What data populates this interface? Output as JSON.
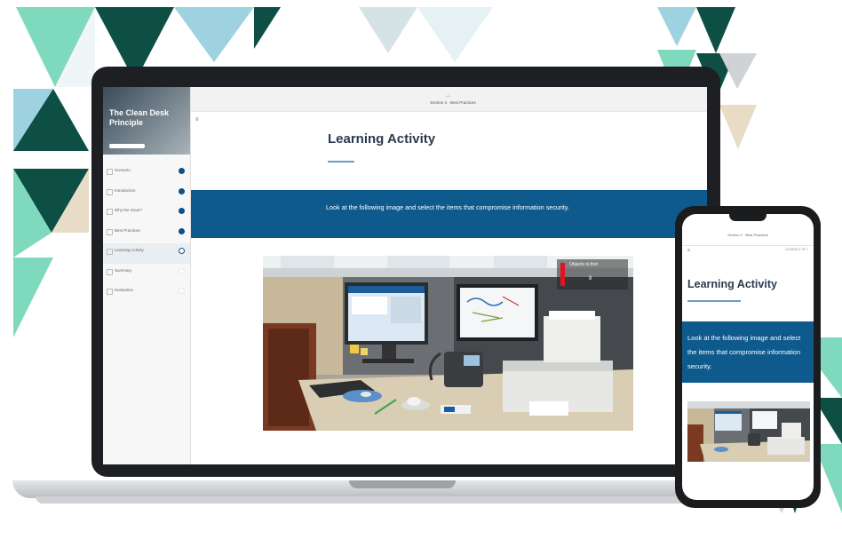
{
  "course": {
    "title": "The Clean Desk Principle",
    "lesson_title": "Section 4 · Best Practices"
  },
  "sidebar": {
    "items": [
      {
        "label": "Scenario",
        "status": "complete"
      },
      {
        "label": "Introduction",
        "status": "complete"
      },
      {
        "label": "Why the Issue?",
        "status": "complete"
      },
      {
        "label": "Best Practices",
        "status": "complete"
      },
      {
        "label": "Learning Activity",
        "status": "in-progress"
      },
      {
        "label": "Summary",
        "status": "not-started"
      },
      {
        "label": "Evaluation",
        "status": "not-started"
      }
    ]
  },
  "activity": {
    "heading": "Learning Activity",
    "instruction": "Look at the following image and select the items that compromise information security.",
    "objects_label": "Objects to find",
    "objects_count": "8"
  },
  "phone": {
    "top_right": "LESSON 4 OF 7"
  },
  "icons": {
    "menu": "hamburger-menu-icon",
    "caret": "chevron-up-icon",
    "complete": "filled-circle-icon",
    "progress": "half-circle-icon"
  },
  "colors": {
    "accent": "#0f5a8c",
    "heading": "#2b3b4e",
    "rule": "#6a9ec7",
    "alert": "#e3121d",
    "deco_dark": "#0e4f45",
    "deco_teal": "#7fd9bd",
    "deco_light": "#a9dce8",
    "deco_beige": "#e8dcc7"
  }
}
